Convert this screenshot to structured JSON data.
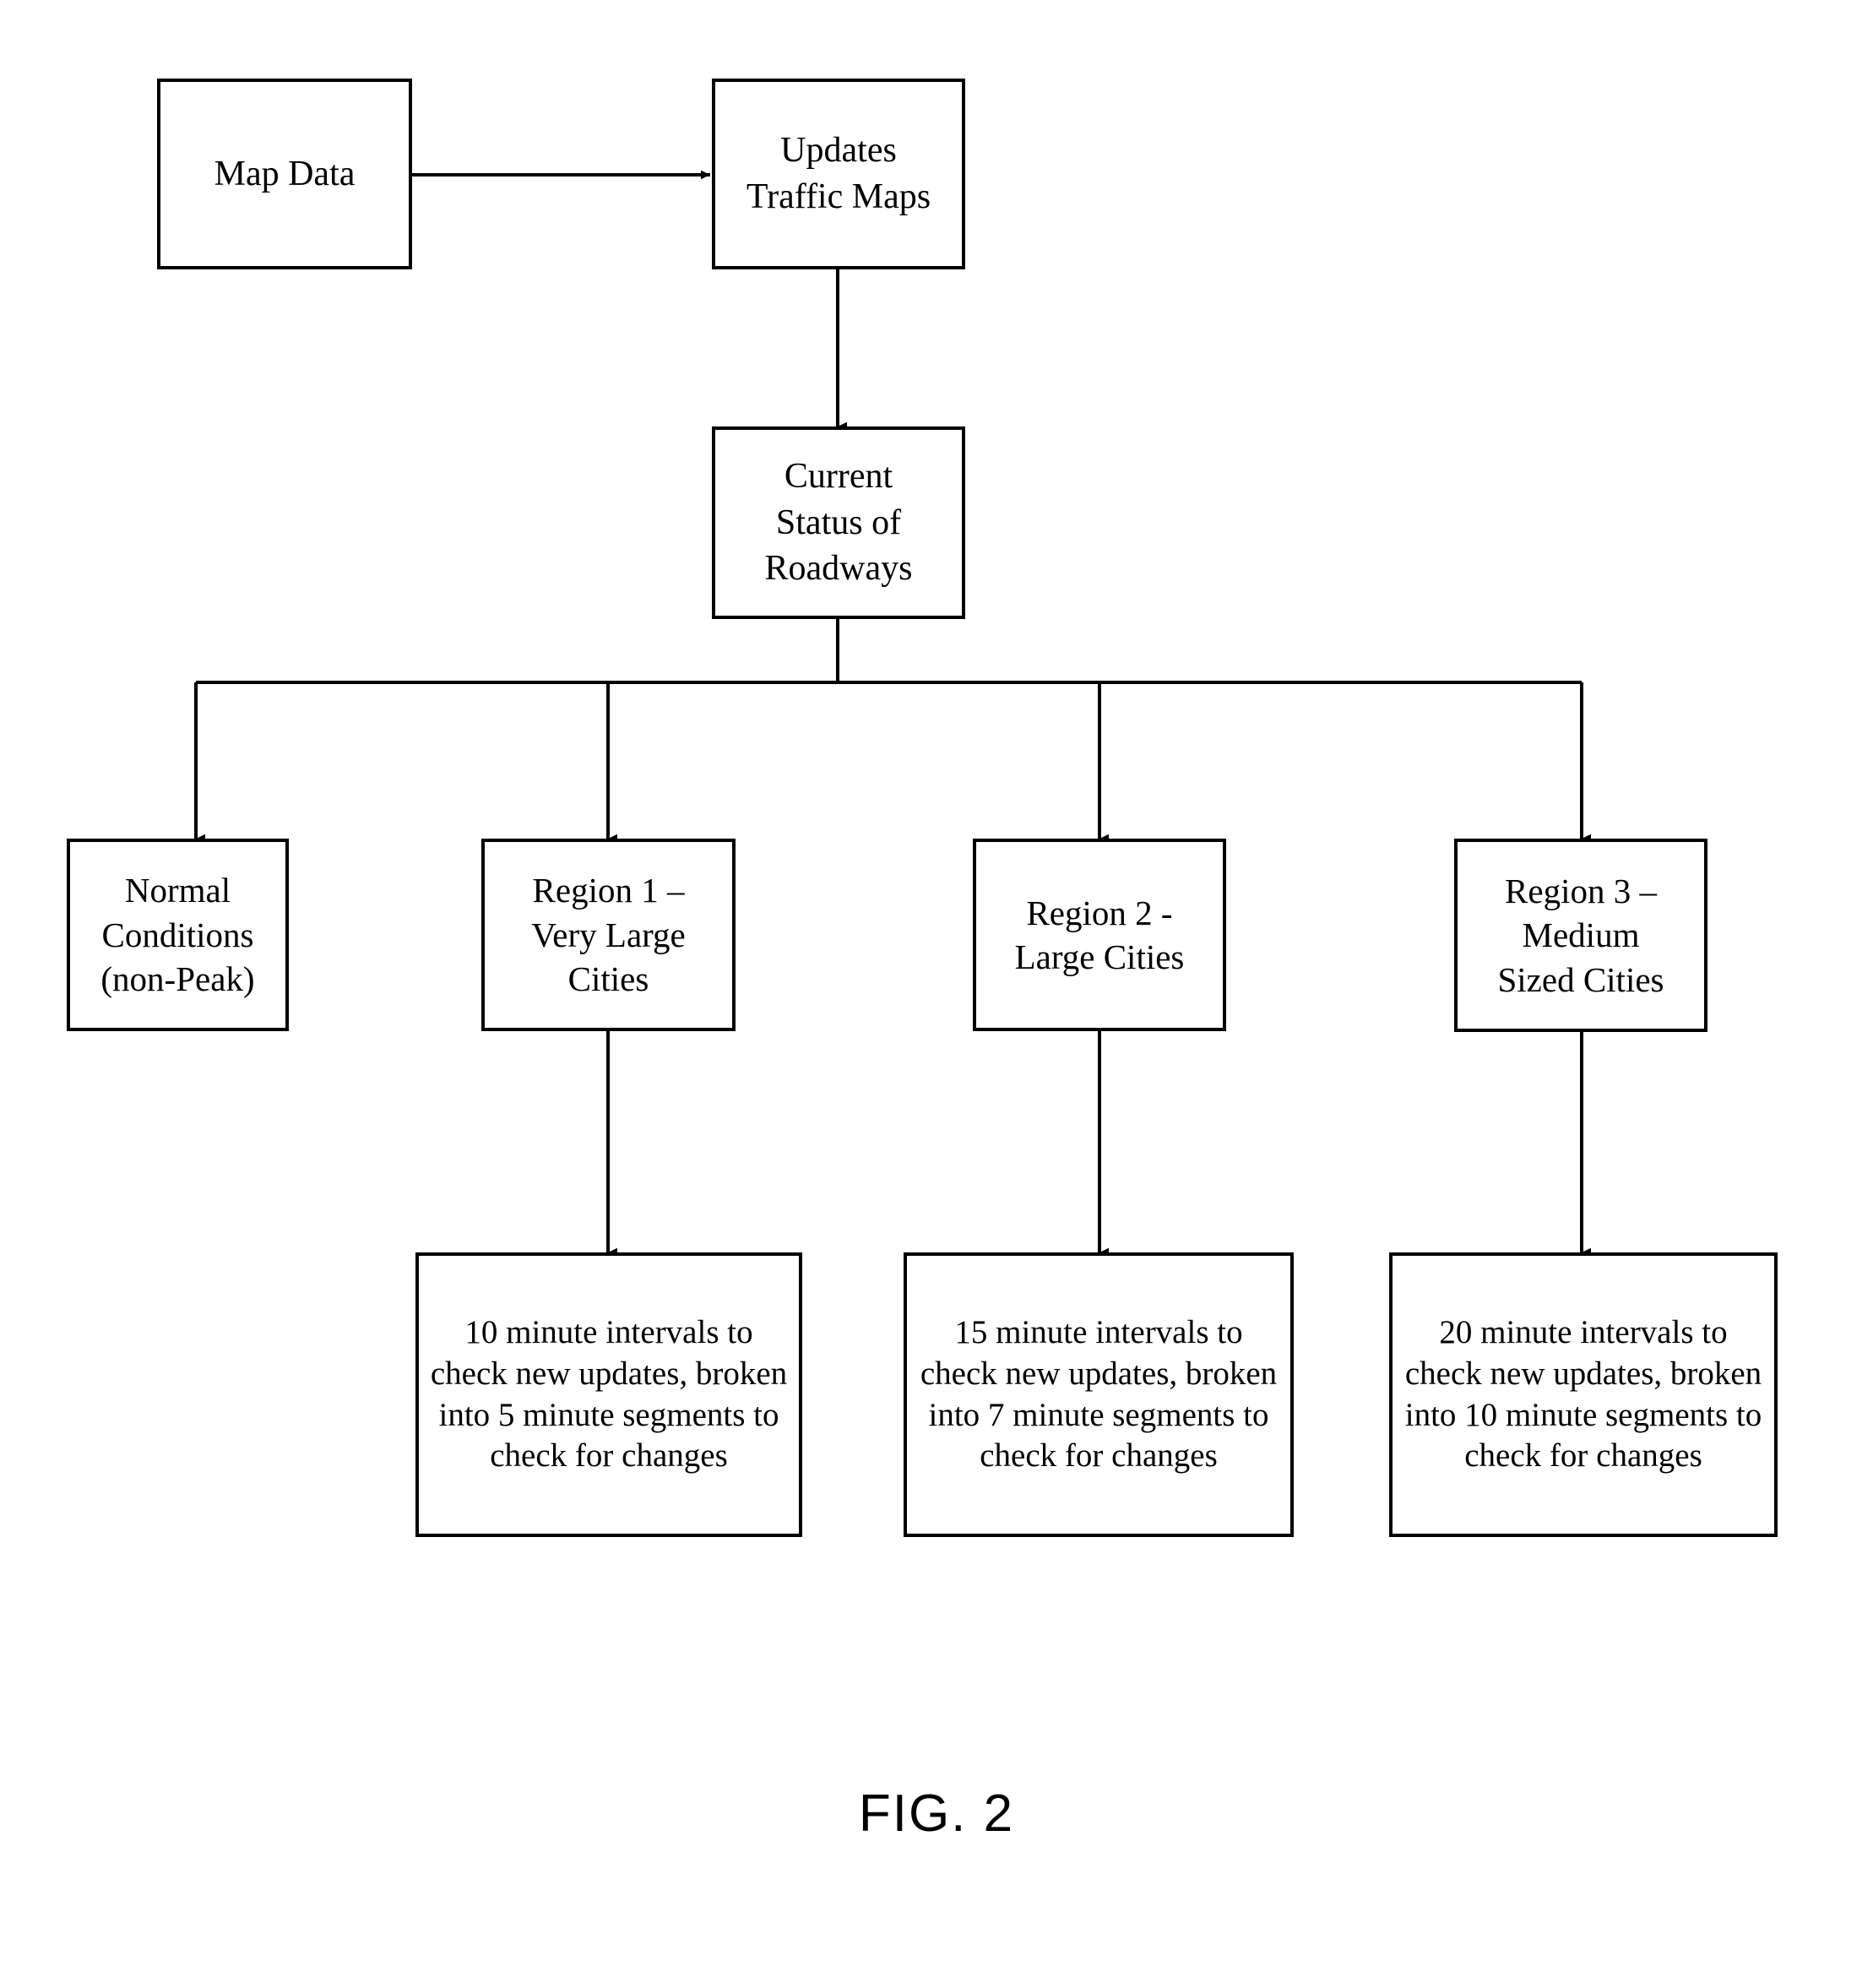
{
  "figure": {
    "caption": "FIG. 2",
    "stroke_color": "#000000",
    "background_color": "#ffffff"
  },
  "nodes": {
    "map_data": {
      "label": "Map Data"
    },
    "updates_traffic_maps": {
      "label": "Updates\nTraffic Maps"
    },
    "current_status": {
      "label": "Current\nStatus of\nRoadways"
    },
    "normal_conditions": {
      "label": "Normal\nConditions\n(non-Peak)"
    },
    "region1": {
      "label": "Region 1 –\nVery Large\nCities"
    },
    "region2": {
      "label": "Region 2 -\nLarge Cities"
    },
    "region3": {
      "label": "Region 3 –\nMedium\nSized Cities"
    },
    "detail1": {
      "label": "10 minute intervals to check new updates, broken into 5 minute segments to check for changes"
    },
    "detail2": {
      "label": "15 minute intervals to check new updates, broken into 7 minute segments to check for changes"
    },
    "detail3": {
      "label": "20 minute intervals to check new updates, broken into 10 minute segments to check for changes"
    }
  },
  "edges": [
    {
      "id": "map-data-to-updates",
      "from": "map_data",
      "to": "updates_traffic_maps",
      "style": "arrow-right"
    },
    {
      "id": "updates-to-current",
      "from": "updates_traffic_maps",
      "to": "current_status",
      "style": "arrow-down"
    },
    {
      "id": "current-to-normal",
      "from": "current_status",
      "to": "normal_conditions",
      "style": "bus-branch-arrow-down"
    },
    {
      "id": "current-to-region1",
      "from": "current_status",
      "to": "region1",
      "style": "bus-branch-arrow-down"
    },
    {
      "id": "current-to-region2",
      "from": "current_status",
      "to": "region2",
      "style": "bus-branch-arrow-down"
    },
    {
      "id": "current-to-region3",
      "from": "current_status",
      "to": "region3",
      "style": "bus-branch-arrow-down"
    },
    {
      "id": "region1-to-detail1",
      "from": "region1",
      "to": "detail1",
      "style": "arrow-down"
    },
    {
      "id": "region2-to-detail2",
      "from": "region2",
      "to": "detail2",
      "style": "arrow-down"
    },
    {
      "id": "region3-to-detail3",
      "from": "region3",
      "to": "detail3",
      "style": "arrow-down"
    }
  ]
}
